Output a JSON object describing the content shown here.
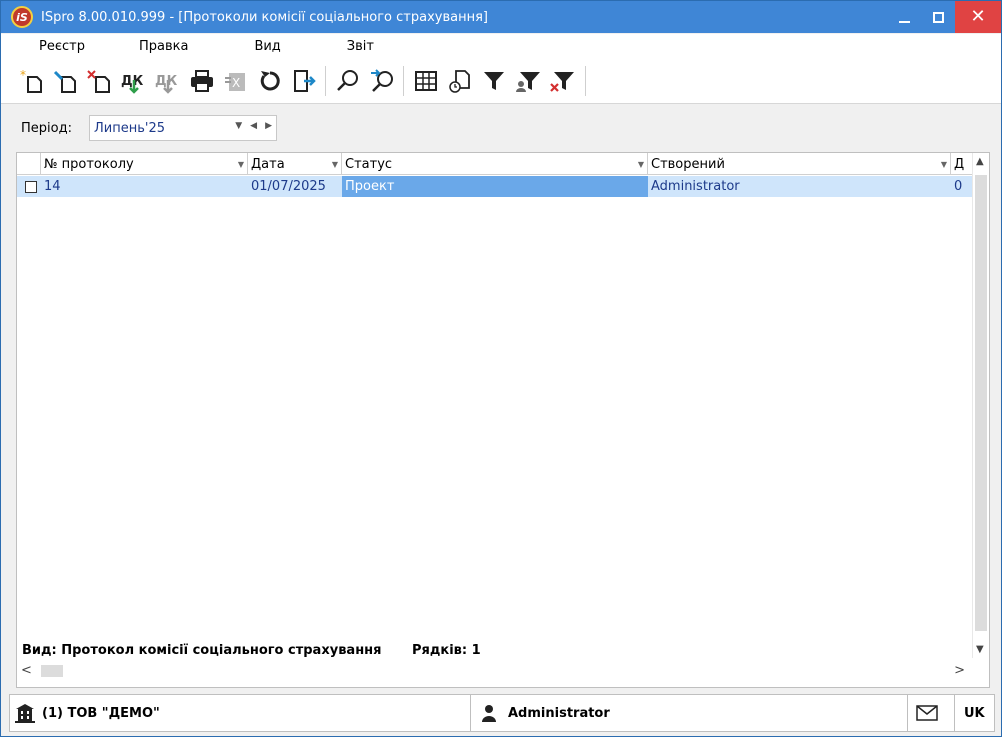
{
  "window": {
    "title": "ISpro 8.00.010.999 - [Протоколи комісії соціального страхування]",
    "logo_text": "iS"
  },
  "menu": [
    "Реєстр",
    "Правка",
    "Вид",
    "Звіт"
  ],
  "toolbar_icons": [
    "create-icon",
    "edit-icon",
    "delete-icon",
    "post-icon",
    "unpost-icon",
    "print-icon",
    "export-icon",
    "refresh-icon",
    "exit-icon",
    "find-icon",
    "find-next-icon",
    "table-view-icon",
    "history-icon",
    "filter-icon",
    "user-filter-icon",
    "clear-filter-icon"
  ],
  "period": {
    "label": "Період:",
    "value": "Липень'25"
  },
  "grid": {
    "columns": [
      {
        "label": "№ протоколу"
      },
      {
        "label": "Дата"
      },
      {
        "label": "Статус"
      },
      {
        "label": "Створений"
      },
      {
        "label": "Д"
      }
    ],
    "rows": [
      {
        "number": "14",
        "date": "01/07/2025",
        "status": "Проект",
        "created_by": "Administrator",
        "extra": "0"
      }
    ]
  },
  "status": {
    "view": "Вид: Протокол комісії соціального страхування",
    "rows": "Рядків: 1"
  },
  "statusbar": {
    "company": "(1) ТОВ \"ДЕМО\"",
    "user": "Administrator",
    "language": "UK"
  },
  "colors": {
    "titlebar": "#3f86d6",
    "close_button": "#e04343",
    "selected_row": "#cfe5fb",
    "selected_cell": "#6aa8e9",
    "data_text": "#1d3a8a"
  }
}
